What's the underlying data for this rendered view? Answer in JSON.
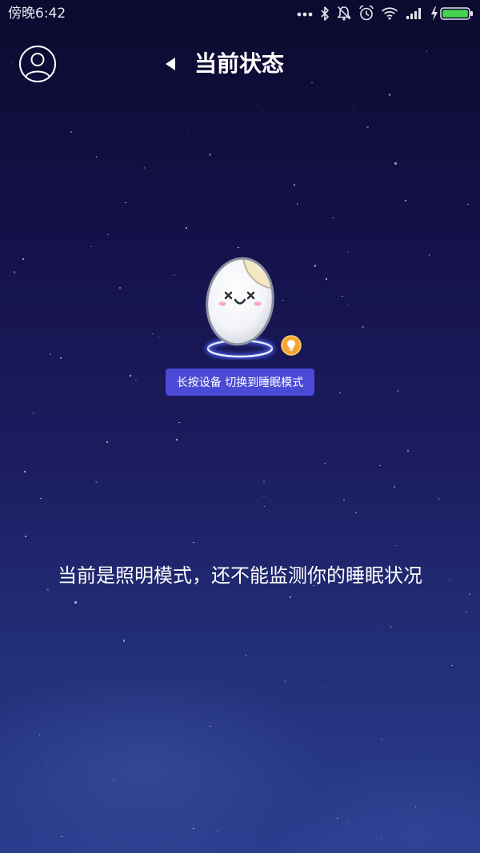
{
  "status_bar": {
    "time": "傍晚6:42",
    "icons": [
      "more-notifications-icon",
      "bluetooth-icon",
      "notifications-muted-icon",
      "alarm-icon",
      "wifi-icon",
      "signal-icon",
      "charging-icon",
      "battery-icon"
    ],
    "battery_fill_color": "#45d24f"
  },
  "header": {
    "avatar_icon": "user-avatar-icon",
    "toggle_icon": "left-triangle-icon",
    "title": "当前状态"
  },
  "device": {
    "character": "egg-lamp-character",
    "mode_icon": "lightbulb-icon",
    "mode_icon_color": "#f6a531",
    "hint": "长按设备 切换到睡眠模式",
    "hint_background": "#4b4ad6"
  },
  "status_message": "当前是照明模式，还不能监测你的睡眠状况",
  "colors": {
    "background_top": "#0c0a2e",
    "background_bottom": "#2a3d8e",
    "text": "#ffffff"
  }
}
